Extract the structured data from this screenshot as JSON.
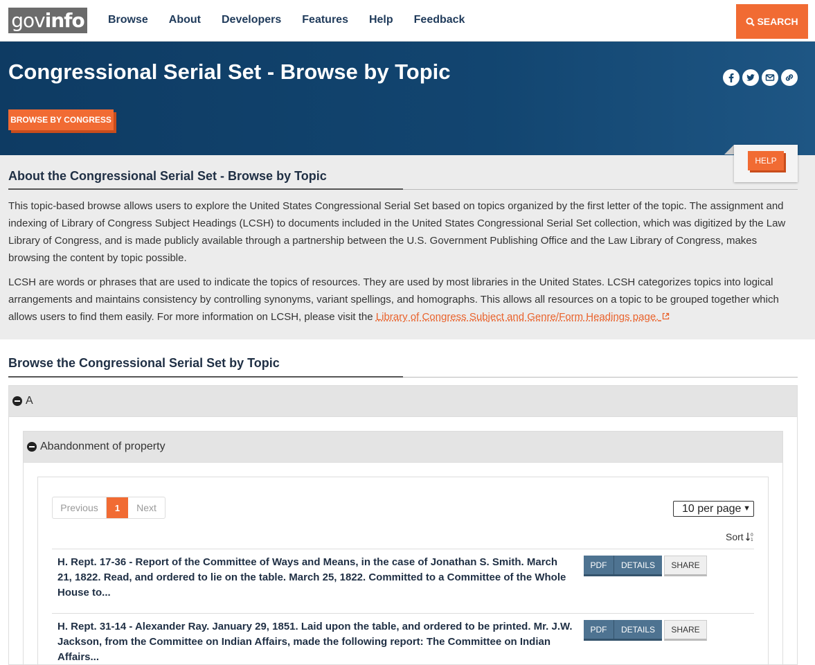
{
  "nav": {
    "logo_light": "gov",
    "logo_bold": "info",
    "links": [
      "Browse",
      "About",
      "Developers",
      "Features",
      "Help",
      "Feedback"
    ],
    "search_label": "SEARCH"
  },
  "hero": {
    "title": "Congressional Serial Set - Browse by Topic",
    "browse_congress_label": "BROWSE BY CONGRESS",
    "social_icons": [
      "facebook-icon",
      "twitter-icon",
      "email-icon",
      "link-icon"
    ]
  },
  "about": {
    "heading": "About the Congressional Serial Set - Browse by Topic",
    "help_label": "HELP",
    "para1": "This topic-based browse allows users to explore the United States Congressional Serial Set based on topics organized by the first letter of the topic. The assignment and indexing of Library of Congress Subject Headings (LCSH) to documents included in the United States Congressional Serial Set collection, which was digitized by the Law Library of Congress, and is made publicly available through a partnership between the U.S. Government Publishing Office and the Law Library of Congress, makes browsing the content by topic possible.",
    "para2_text": "LCSH are words or phrases that are used to indicate the topics of resources. They are used by most libraries in the United States. LCSH categorizes topics into logical arrangements and maintains consistency by controlling synonyms, variant spellings, and homographs. This allows all resources on a topic to be grouped together which allows users to find them easily. For more information on LCSH, please visit the ",
    "para2_link": "Library of Congress Subject and Genre/Form Headings page."
  },
  "browse": {
    "heading": "Browse the Congressional Serial Set by Topic",
    "letter": "A",
    "topic": "Abandonment of property",
    "pager": {
      "prev": "Previous",
      "current": "1",
      "next": "Next"
    },
    "per_page": "10 per page",
    "sort_label": "Sort",
    "results": [
      {
        "title": "H. Rept. 17-36 - Report of the Committee of Ways and Means, in the case of Jonathan S. Smith. March 21, 1822. Read, and ordered to lie on the table. March 25, 1822. Committed to a Committee of the Whole House to...",
        "pdf": "PDF",
        "details": "DETAILS",
        "share": "SHARE"
      },
      {
        "title": "H. Rept. 31-14 - Alexander Ray. January 29, 1851. Laid upon the table, and ordered to be printed. Mr. J.W. Jackson, from the Committee on Indian Affairs, made the following report: The Committee on Indian Affairs...",
        "pdf": "PDF",
        "details": "DETAILS",
        "share": "SHARE"
      }
    ]
  },
  "colors": {
    "accent": "#f16b33",
    "hero_bg": "#124570",
    "button_blue": "#4e7391"
  }
}
